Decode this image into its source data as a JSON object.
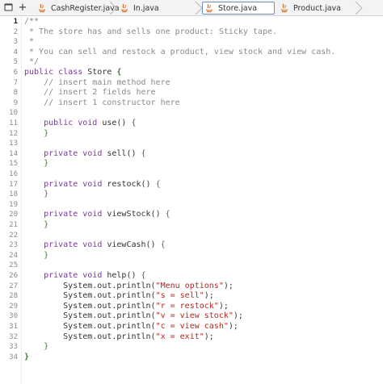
{
  "toolbar": {
    "menu_icon": "window-icon",
    "add_label": "+"
  },
  "tabs": [
    {
      "label": "CashRegister.java",
      "active": false
    },
    {
      "label": "In.java",
      "active": false
    },
    {
      "label": "Store.java",
      "active": true
    },
    {
      "label": "Product.java",
      "active": false
    }
  ],
  "editor": {
    "current_line": 1,
    "lines": [
      {
        "n": "1",
        "t": [
          [
            "c",
            "/**"
          ]
        ]
      },
      {
        "n": "2",
        "t": [
          [
            "c",
            " * The store has and sells one product: Sticky tape."
          ]
        ]
      },
      {
        "n": "3",
        "t": [
          [
            "c",
            " *"
          ]
        ]
      },
      {
        "n": "4",
        "t": [
          [
            "c",
            " * You can sell and restock a product, view stock and view cash."
          ]
        ]
      },
      {
        "n": "5",
        "t": [
          [
            "c",
            " */"
          ]
        ]
      },
      {
        "n": "6",
        "t": [
          [
            "k",
            "public class"
          ],
          [
            "p",
            " Store "
          ],
          [
            "bb",
            "{"
          ]
        ]
      },
      {
        "n": "7",
        "t": [
          [
            "c",
            "    // insert main method here"
          ]
        ]
      },
      {
        "n": "8",
        "t": [
          [
            "c",
            "    // insert 2 fields here"
          ]
        ]
      },
      {
        "n": "9",
        "t": [
          [
            "c",
            "    // insert 1 constructor here"
          ]
        ]
      },
      {
        "n": "10",
        "t": []
      },
      {
        "n": "11",
        "t": [
          [
            "p",
            "    "
          ],
          [
            "k",
            "public void"
          ],
          [
            "p",
            " use() "
          ],
          [
            "b",
            "{"
          ]
        ]
      },
      {
        "n": "12",
        "t": [
          [
            "p",
            "    "
          ],
          [
            "b",
            "}"
          ]
        ]
      },
      {
        "n": "13",
        "t": []
      },
      {
        "n": "14",
        "t": [
          [
            "p",
            "    "
          ],
          [
            "k",
            "private void"
          ],
          [
            "p",
            " sell() "
          ],
          [
            "b",
            "{"
          ]
        ]
      },
      {
        "n": "15",
        "t": [
          [
            "p",
            "    "
          ],
          [
            "b",
            "}"
          ]
        ]
      },
      {
        "n": "16",
        "t": []
      },
      {
        "n": "17",
        "t": [
          [
            "p",
            "    "
          ],
          [
            "k",
            "private void"
          ],
          [
            "p",
            " restock() "
          ],
          [
            "b",
            "{"
          ]
        ]
      },
      {
        "n": "18",
        "t": [
          [
            "p",
            "    "
          ],
          [
            "b",
            "}"
          ]
        ]
      },
      {
        "n": "19",
        "t": []
      },
      {
        "n": "20",
        "t": [
          [
            "p",
            "    "
          ],
          [
            "k",
            "private void"
          ],
          [
            "p",
            " viewStock() "
          ],
          [
            "b",
            "{"
          ]
        ]
      },
      {
        "n": "21",
        "t": [
          [
            "p",
            "    "
          ],
          [
            "b",
            "}"
          ]
        ]
      },
      {
        "n": "22",
        "t": []
      },
      {
        "n": "23",
        "t": [
          [
            "p",
            "    "
          ],
          [
            "k",
            "private void"
          ],
          [
            "p",
            " viewCash() "
          ],
          [
            "b",
            "{"
          ]
        ]
      },
      {
        "n": "24",
        "t": [
          [
            "p",
            "    "
          ],
          [
            "b",
            "}"
          ]
        ]
      },
      {
        "n": "25",
        "t": []
      },
      {
        "n": "26",
        "t": [
          [
            "p",
            "    "
          ],
          [
            "k",
            "private void"
          ],
          [
            "p",
            " help() "
          ],
          [
            "b",
            "{"
          ]
        ]
      },
      {
        "n": "27",
        "t": [
          [
            "p",
            "        System.out.println("
          ],
          [
            "s",
            "\"Menu options\""
          ],
          [
            "p",
            ");"
          ]
        ]
      },
      {
        "n": "28",
        "t": [
          [
            "p",
            "        System.out.println("
          ],
          [
            "s",
            "\"s = sell\""
          ],
          [
            "p",
            ");"
          ]
        ]
      },
      {
        "n": "29",
        "t": [
          [
            "p",
            "        System.out.println("
          ],
          [
            "s",
            "\"r = restock\""
          ],
          [
            "p",
            ");"
          ]
        ]
      },
      {
        "n": "30",
        "t": [
          [
            "p",
            "        System.out.println("
          ],
          [
            "s",
            "\"v = view stock\""
          ],
          [
            "p",
            ");"
          ]
        ]
      },
      {
        "n": "31",
        "t": [
          [
            "p",
            "        System.out.println("
          ],
          [
            "s",
            "\"c = view cash\""
          ],
          [
            "p",
            ");"
          ]
        ]
      },
      {
        "n": "32",
        "t": [
          [
            "p",
            "        System.out.println("
          ],
          [
            "s",
            "\"x = exit\""
          ],
          [
            "p",
            ");"
          ]
        ]
      },
      {
        "n": "33",
        "t": [
          [
            "p",
            "    "
          ],
          [
            "b",
            "}"
          ]
        ]
      },
      {
        "n": "34",
        "t": [
          [
            "bb",
            "}"
          ]
        ]
      }
    ]
  }
}
